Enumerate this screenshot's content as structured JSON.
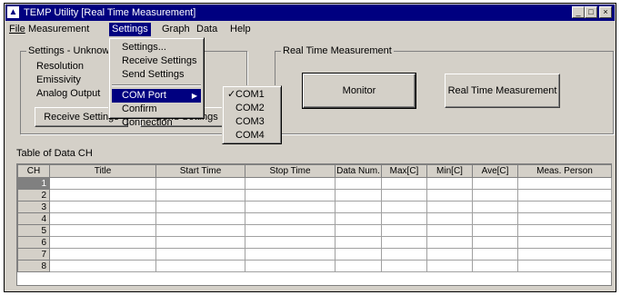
{
  "window": {
    "title": "TEMP Utility [Real Time Measurement]",
    "minimize": "_",
    "maximize": "□",
    "close": "×"
  },
  "menubar": {
    "file": "File",
    "measurement": "Measurement",
    "settings": "Settings",
    "graph": "Graph",
    "data": "Data",
    "help": "Help"
  },
  "settings_group": {
    "title": "Settings - Unknown",
    "resolution": "Resolution",
    "emissivity": "Emissivity",
    "analog_output": "Analog Output",
    "receive_button": "Receive Settings",
    "send_button": "Send Settings"
  },
  "realtime_group": {
    "title": "Real Time Measurement",
    "monitor_button": "Monitor",
    "realtime_button": "Real Time Measurement"
  },
  "table": {
    "caption": "Table of Data CH",
    "columns": [
      "CH",
      "Title",
      "Start Time",
      "Stop Time",
      "Data Num.",
      "Max[C]",
      "Min[C]",
      "Ave[C]",
      "Meas. Person"
    ],
    "rows": [
      "1",
      "2",
      "3",
      "4",
      "5",
      "6",
      "7",
      "8"
    ]
  },
  "settings_menu": {
    "items": [
      "Settings...",
      "Receive Settings",
      "Send Settings",
      "COM Port",
      "Confirm Connection"
    ],
    "submenu_arrow": "▶"
  },
  "com_submenu": {
    "checkmark": "✓",
    "items": [
      "COM1",
      "COM2",
      "COM3",
      "COM4"
    ],
    "selected": "COM1"
  }
}
